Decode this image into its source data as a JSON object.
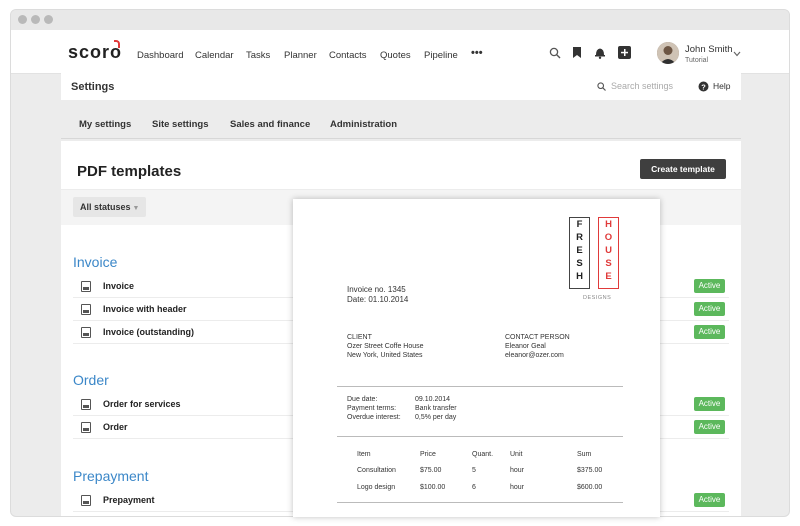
{
  "nav": {
    "logo": "scoro",
    "items": [
      "Dashboard",
      "Calendar",
      "Tasks",
      "Planner",
      "Contacts",
      "Quotes",
      "Pipeline"
    ],
    "more": "•••",
    "icons": [
      "search-icon",
      "bookmark-icon",
      "bell-icon",
      "plus-icon"
    ],
    "user_name": "John Smith",
    "user_sub": "Tutorial"
  },
  "settings": {
    "title": "Settings",
    "search_placeholder": "Search settings",
    "help": "Help"
  },
  "tabs": [
    "My settings",
    "Site settings",
    "Sales and finance",
    "Administration"
  ],
  "page": {
    "title": "PDF templates",
    "create_button": "Create template",
    "status_filter": "All statuses"
  },
  "sections": [
    {
      "title": "Invoice",
      "rows": [
        {
          "name": "Invoice",
          "status": "Active"
        },
        {
          "name": "Invoice with header",
          "status": "Active"
        },
        {
          "name": "Invoice (outstanding)",
          "status": "Active"
        }
      ]
    },
    {
      "title": "Order",
      "rows": [
        {
          "name": "Order for services",
          "status": "Active"
        },
        {
          "name": "Order",
          "status": "Active"
        }
      ]
    },
    {
      "title": "Prepayment",
      "rows": [
        {
          "name": "Prepayment",
          "status": "Active"
        }
      ]
    }
  ],
  "pdf": {
    "logo_left": [
      "F",
      "R",
      "E",
      "S",
      "H"
    ],
    "logo_right": [
      "H",
      "O",
      "U",
      "S",
      "E"
    ],
    "logo_sub": "DESIGNS",
    "invoice_no": "Invoice no. 1345",
    "date": "Date:  01.10.2014",
    "client_label": "CLIENT",
    "client_name": "Ozer Street Coffe House",
    "client_city": "New York, United States",
    "contact_label": "CONTACT PERSON",
    "contact_name": "Eleanor Geal",
    "contact_email": "eleanor@ozer.com",
    "terms": [
      {
        "label": "Due date:",
        "value": "09.10.2014"
      },
      {
        "label": "Payment terms:",
        "value": "Bank transfer"
      },
      {
        "label": "Overdue interest:",
        "value": "0,5% per day"
      }
    ],
    "table_headers": [
      "Item",
      "Price",
      "Quant.",
      "Unit",
      "Sum"
    ],
    "table_rows": [
      [
        "Consultation",
        "$75.00",
        "5",
        "hour",
        "$375.00"
      ],
      [
        "Logo design",
        "$100.00",
        "6",
        "hour",
        "$600.00"
      ]
    ]
  },
  "colors": {
    "accent": "#3b87c8",
    "active_badge": "#5cb85c",
    "brand_red": "#e03a3a",
    "dark_button": "#3f3f3f"
  }
}
